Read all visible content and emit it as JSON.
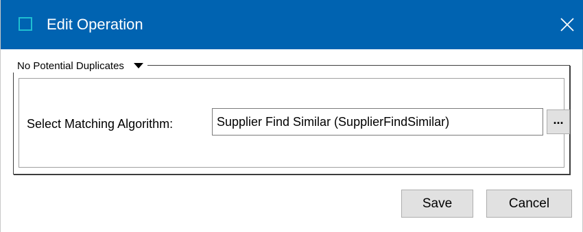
{
  "window": {
    "title": "Edit Operation",
    "titlebar_color": "#0063b1",
    "icons": {
      "app": "window-icon",
      "close": "close-icon"
    }
  },
  "group": {
    "legend": "No Potential Duplicates",
    "legend_icon": "caret-down-icon"
  },
  "form": {
    "algorithm_label": "Select Matching Algorithm:",
    "algorithm_value": "Supplier Find Similar (SupplierFindSimilar)",
    "browse_label": "..."
  },
  "buttons": {
    "save": "Save",
    "cancel": "Cancel"
  }
}
